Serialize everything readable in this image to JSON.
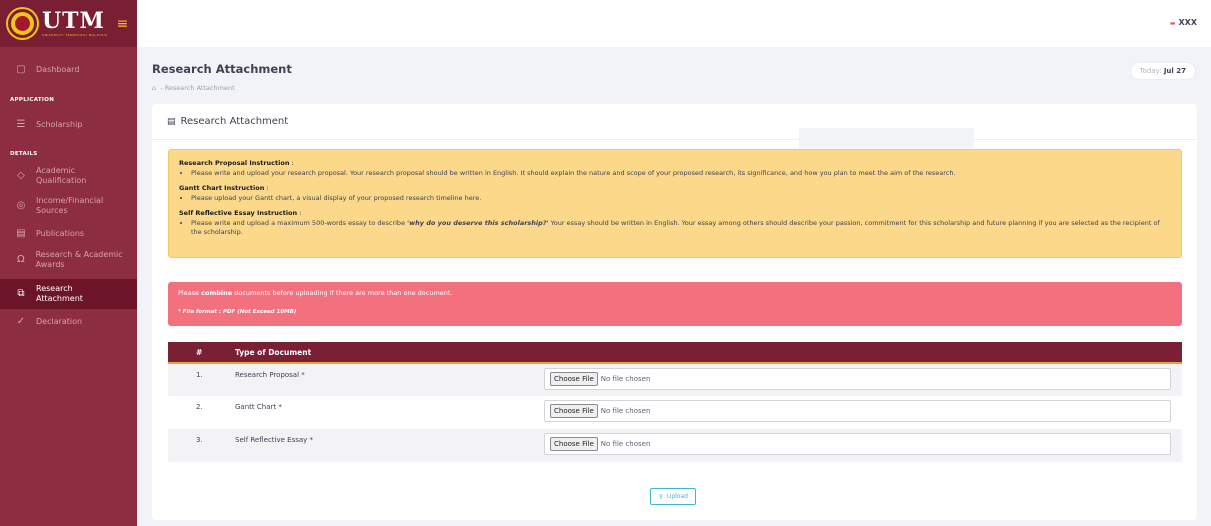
{
  "brand": {
    "name": "UTM",
    "subtitle": "UNIVERSITI TEKNOLOGI MALAYSIA",
    "menu_icon": "hamburger-icon"
  },
  "sidebar": {
    "dashboard": {
      "label": "Dashboard",
      "icon": "dashboard-icon"
    },
    "section_application": "APPLICATION",
    "scholarship": {
      "label": "Scholarship",
      "icon": "list-icon"
    },
    "section_details": "DETAILS",
    "items": [
      {
        "label": "Academic Qualification",
        "icon": "graduation-icon"
      },
      {
        "label": "Income/Financial Sources",
        "icon": "money-icon"
      },
      {
        "label": "Publications",
        "icon": "document-icon"
      },
      {
        "label": "Research & Academic Awards",
        "icon": "award-icon"
      },
      {
        "label": "Research Attachment",
        "icon": "attachment-icon"
      },
      {
        "label": "Declaration",
        "icon": "check-icon"
      }
    ]
  },
  "header": {
    "user": "XXX"
  },
  "subheader": {
    "title": "Research Attachment",
    "breadcrumb": "- Research Attachment",
    "today_label": "Today:",
    "today_value": "Jul 27"
  },
  "card": {
    "title": "Research Attachment",
    "instructions": [
      {
        "heading": "Research Proposal Instruction",
        "text": "Please write and upload your research proposal. Your research proposal should be written in English. It should explain the nature and scope of your proposed research, its significance, and how you plan to meet the aim of the research."
      },
      {
        "heading": "Gantt Chart Instruction",
        "text": "Please upload your Gantt chart, a visual display of your proposed research timeline here."
      },
      {
        "heading": "Self Reflective Essay Instruction",
        "text_before": "Please write and upload a maximum 500-words essay to describe ",
        "emphasis": "'why do you deserve this scholarship?'",
        "text_after": " Your essay should be written in English. Your essay among others should describe your passion, commitment for this scholarship and future planning if you are selected as the recipient of the scholarship."
      }
    ],
    "warning": {
      "before": "Please ",
      "bold": "combine",
      "after": " documents before uploading if there are more than one document.",
      "format": "* File format : PDF (Not Exceed 10MB)"
    },
    "table": {
      "headers": [
        "#",
        "Type of Document"
      ],
      "rows": [
        {
          "no": "1.",
          "name": "Research Proposal *",
          "button": "Choose File",
          "status": "No file chosen"
        },
        {
          "no": "2.",
          "name": "Gantt Chart *",
          "button": "Choose File",
          "status": "No file chosen"
        },
        {
          "no": "3.",
          "name": "Self Reflective Essay *",
          "button": "Choose File",
          "status": "No file chosen"
        }
      ]
    },
    "upload_label": "Upload"
  }
}
